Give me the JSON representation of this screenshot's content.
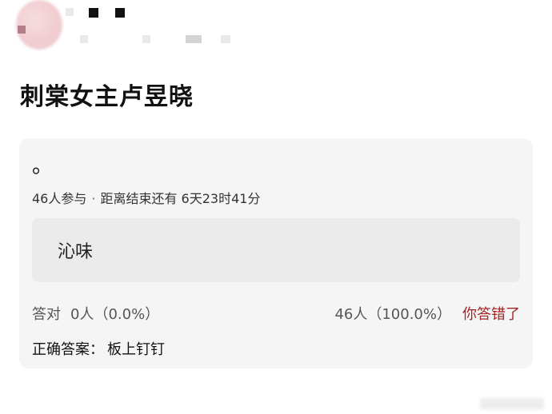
{
  "post": {
    "title": "刺棠女主卢昱晓"
  },
  "quiz": {
    "question": "。",
    "participants": "46人参与",
    "separator": "·",
    "time_left": "距离结束还有 6天23时41分",
    "option": {
      "label": "沁味"
    },
    "correct_stats": {
      "label": "答对",
      "value": "0人（0.0%）"
    },
    "wrong_stats": {
      "value": "46人（100.0%）",
      "label": "你答错了"
    },
    "answer": {
      "label": "正确答案：",
      "value": "板上钉钉"
    }
  },
  "colors": {
    "wrong_label": "#a22424",
    "card_bg": "#f5f5f5",
    "option_bg": "#ebebeb"
  }
}
